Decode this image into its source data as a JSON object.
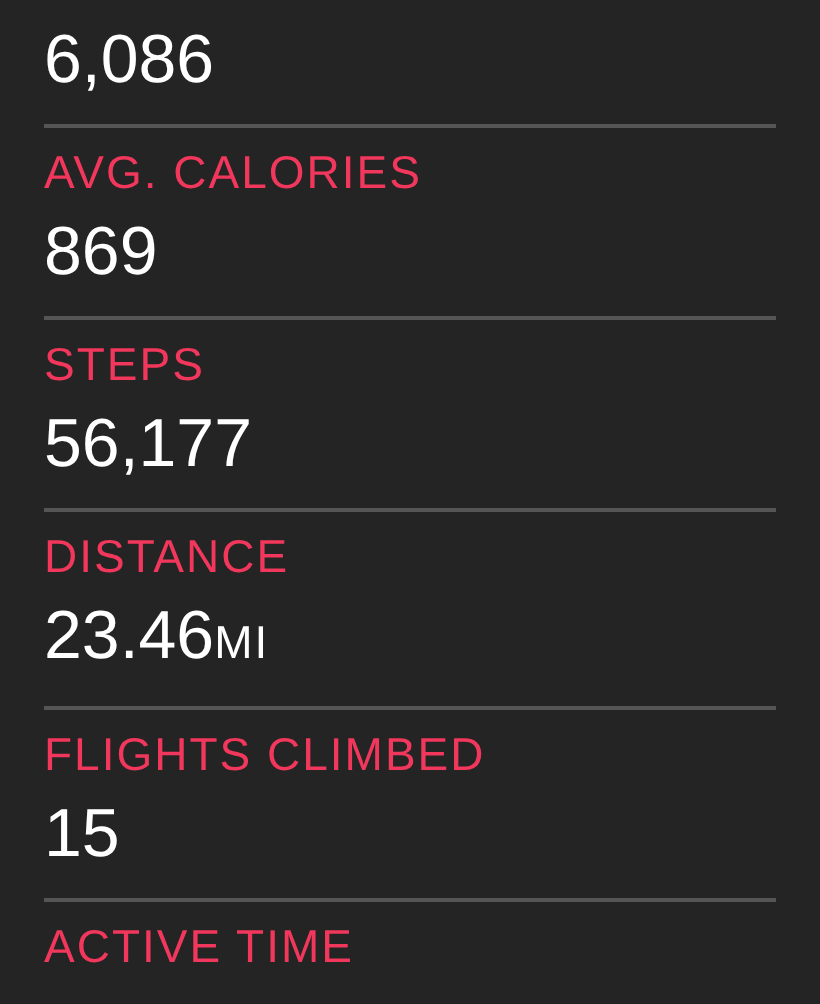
{
  "stats": [
    {
      "value": "6,086"
    },
    {
      "label": "AVG. CALORIES",
      "value": "869"
    },
    {
      "label": "STEPS",
      "value": "56,177"
    },
    {
      "label": "DISTANCE",
      "value": "23.46",
      "unit": "MI"
    },
    {
      "label": "FLIGHTS CLIMBED",
      "value": "15"
    },
    {
      "label": "ACTIVE TIME"
    }
  ]
}
